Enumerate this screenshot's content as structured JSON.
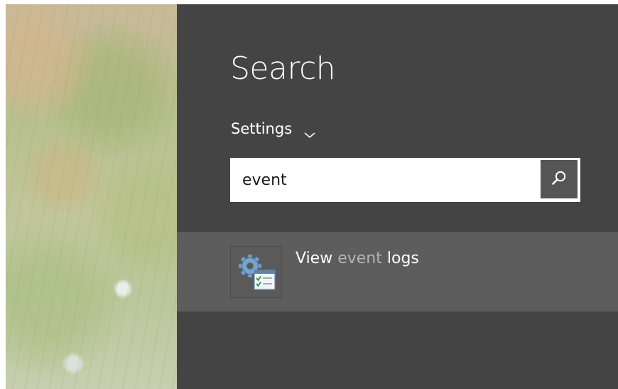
{
  "search_pane": {
    "title": "Search",
    "scope": {
      "label": "Settings",
      "icon": "chevron-down-icon"
    },
    "search_box": {
      "value": "event",
      "placeholder": "",
      "button_icon": "search-icon"
    },
    "results": [
      {
        "icon": "event-viewer-icon",
        "label_parts": [
          "View ",
          "event",
          " logs"
        ],
        "highlight": "event"
      }
    ]
  },
  "colors": {
    "panel_bg": "#444444",
    "result_bg": "#5d5d5d",
    "search_button_bg": "#555555",
    "highlight_text": "#b3b3b3",
    "text": "#ffffff"
  }
}
